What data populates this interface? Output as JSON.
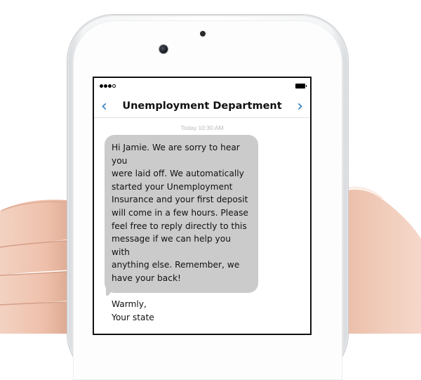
{
  "colors": {
    "accent": "#2a7bbd",
    "bubble": "#cbcbcb",
    "timestamp": "#b8b8b8"
  },
  "status_bar": {
    "signal_icon": "signal-dots-icon",
    "battery_icon": "battery-icon"
  },
  "conversation": {
    "title": "Unemployment Department",
    "back_icon": "chevron-left-icon",
    "forward_icon": "chevron-right-icon"
  },
  "messages": [
    {
      "timestamp": "Today 10:30 AM",
      "lines": [
        "Hi Jamie. We are sorry to hear you",
        "were laid off. We automatically",
        "started your Unemployment",
        "Insurance and your first deposit",
        "will come in a few hours. Please",
        "feel free to reply directly to this",
        "message if we can help you with",
        "anything else. Remember, we",
        "have your back!"
      ],
      "signoff": [
        "Warmly,",
        "Your state"
      ]
    }
  ]
}
